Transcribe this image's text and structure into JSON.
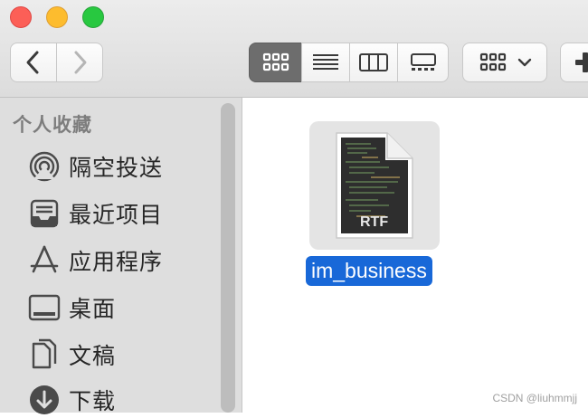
{
  "window": {
    "traffic_lights": [
      "close",
      "minimize",
      "zoom"
    ]
  },
  "toolbar": {
    "back_icon": "chevron-left-icon",
    "forward_icon": "chevron-right-icon",
    "view_modes": [
      "icon-view",
      "list-view",
      "column-view",
      "gallery-view"
    ],
    "selected_view": "icon-view",
    "group_icon": "grid-icon"
  },
  "sidebar": {
    "section_title": "个人收藏",
    "items": [
      {
        "label": "隔空投送",
        "icon": "airdrop-icon"
      },
      {
        "label": "最近项目",
        "icon": "recents-icon"
      },
      {
        "label": "应用程序",
        "icon": "applications-icon"
      },
      {
        "label": "桌面",
        "icon": "desktop-icon"
      },
      {
        "label": "文稿",
        "icon": "documents-icon"
      },
      {
        "label": "下载",
        "icon": "downloads-icon"
      }
    ]
  },
  "content": {
    "file": {
      "name": "im_business",
      "type_badge": "RTF",
      "selected": true
    }
  },
  "watermark": "CSDN @liuhmmjj",
  "colors": {
    "selection": "#1868d8",
    "sidebar_bg": "#dedede",
    "toolbar_bg": "#e5e5e5"
  }
}
